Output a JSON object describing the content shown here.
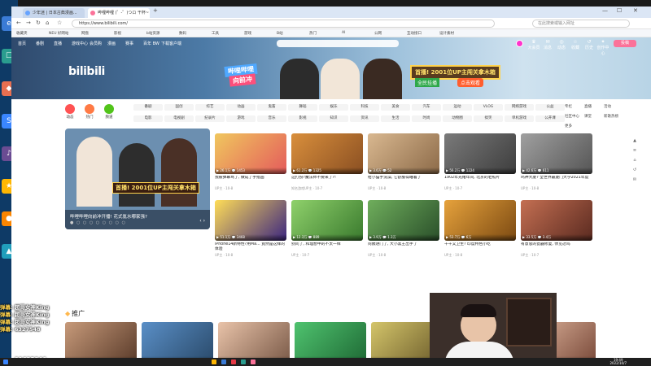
{
  "browser": {
    "tabs": [
      {
        "label": "少年迷 | 日本古典漫画..."
      },
      {
        "label": "哔哩哔哩 (゜-゜)つロ 干杯~"
      }
    ],
    "url": "https://www.bilibili.com/",
    "search_placeholder": "在此搜索或输入网址",
    "bookmarks": [
      "收藏夹",
      "NEU 好网站",
      "网盘",
      "影视",
      "b站资源",
      "数码",
      "工具",
      "游戏",
      "B站",
      "热门",
      "AI",
      "公网",
      "互动接口",
      "设计素材"
    ]
  },
  "nav": {
    "items": [
      "首页",
      "番剧",
      "直播",
      "游戏中心",
      "会员购",
      "漫画",
      "赛事",
      "百年 BW",
      "下载客户端"
    ],
    "right": [
      {
        "icon": "crown-icon",
        "label": "大会员"
      },
      {
        "icon": "message-icon",
        "label": "消息"
      },
      {
        "icon": "dynamic-icon",
        "label": "动态"
      },
      {
        "icon": "star-icon",
        "label": "收藏"
      },
      {
        "icon": "history-icon",
        "label": "历史"
      },
      {
        "icon": "bulb-icon",
        "label": "创作中心"
      }
    ],
    "upload": "投稿"
  },
  "banner": {
    "logo": "bilibili",
    "slogan_top": "哔哩哔哩",
    "slogan_bottom": "向前冲",
    "promo": "首播! 2001位UP主闯关拿木箱",
    "promo_sub": "全民挂播",
    "promo_btn": "点击观看"
  },
  "channels": {
    "big": [
      {
        "label": "动态",
        "color": "#ff5252"
      },
      {
        "label": "热门",
        "color": "#ff7a45"
      },
      {
        "label": "频道",
        "color": "#52c41a"
      }
    ],
    "row1": [
      "番剧",
      "国创",
      "综艺",
      "动画",
      "鬼畜",
      "舞蹈",
      "娱乐",
      "科技",
      "美食",
      "汽车",
      "运动",
      "VLOG",
      "网络游戏",
      "公益"
    ],
    "row2": [
      "电影",
      "电视剧",
      "纪录片",
      "游戏",
      "音乐",
      "影视",
      "知识",
      "资讯",
      "生活",
      "时尚",
      "动物圈",
      "搞笑",
      "单机游戏",
      "公开课"
    ],
    "side": [
      "专栏",
      "直播",
      "活动",
      "社区中心",
      "课堂",
      "新歌热榜",
      "更多"
    ]
  },
  "carousel": {
    "title": "哔哩哔哩向前冲开播! 花式氪水哪家强?",
    "badge": "首播! 2001位UP主闯关拿木箱",
    "dots": "● ○ ○ ○ ○ ○ ○ ○ ○"
  },
  "cards_top": [
    {
      "title": "我被弹幕骂了, 做成了手指画",
      "author": "UP主 · 10-8",
      "stats": "▶ 26.1万  💬 1453",
      "c1": "#f0c75e",
      "c2": "#e45b5b"
    },
    {
      "title": "这打扮?魔法师不要来了?!",
      "author": "知名游戏UP主 · 10-7",
      "stats": "▶ 61.2万  💬 1325",
      "c1": "#d98f3c",
      "c2": "#8a4f22"
    },
    {
      "title": "给小猫手洗澡, 它舒服得睡着了",
      "author": "UP主 · 10-8",
      "stats": "▶ 3.6万  💬 52",
      "c1": "#d9b890",
      "c2": "#8c6a48"
    },
    {
      "title": "1902年光绪年间, 北京的老照片",
      "author": "UP主 · 10-7",
      "stats": "▶ 56.2万  💬 1224",
      "c1": "#7a7a7a",
      "c2": "#3d3d3d"
    },
    {
      "title": "鸣神大厦? 全世界最厦门大学2021年度",
      "author": "UP主 · 10-8",
      "stats": "▶ 42.6万  💬 611",
      "c1": "#a0a0a0",
      "c2": "#555"
    }
  ],
  "cards_mid": [
    {
      "title": "iPhone14新特性?用Ma... 竟然是这样的体验",
      "author": "UP主 · 10-8",
      "stats": "▶ 51.1万  💬 3468",
      "c1": "#ffdd57",
      "c2": "#3b2580"
    },
    {
      "title": "别问了, 和理想中的不太一样",
      "author": "UP主 · 10-7",
      "stats": "▶ 12.3万  💬 889",
      "c1": "#8fd16b",
      "c2": "#3a7a2e"
    },
    {
      "title": "阿姨进门了, 大小黑王出手了",
      "author": "UP主 · 10-8",
      "stats": "▶ 3.9万  💬 1.3万",
      "c1": "#6fae5c",
      "c2": "#2a4f2a"
    },
    {
      "title": "干干又卫生? 印度特色小吃",
      "author": "UP主 · 10-8",
      "stats": "▶ 53.7万  💬 6万",
      "c1": "#e6a23c",
      "c2": "#7c4a12"
    },
    {
      "title": "有意思的瓷器修复, 你见过吗",
      "author": "UP主 · 10-7",
      "stats": "▶ 33.5万  💬 3.4万",
      "c1": "#c46f52",
      "c2": "#5a2a20"
    }
  ],
  "section": {
    "title": "推广"
  },
  "cards_promo": [
    {
      "title": "【我的】短不要嘛一小时, 即将...",
      "author": "UP主 · 10-8",
      "stats": "",
      "c1": "#c79a7a",
      "c2": "#5a3b2a"
    },
    {
      "title": "看完我的智能动画挑战剧了",
      "author": "UP主 · 10-8",
      "stats": "",
      "c1": "#5a8fc7",
      "c2": "#2a4a6a"
    },
    {
      "title": "广告 挑战剧情一小时",
      "author": "UP主 · 10-8",
      "stats": "",
      "c1": "#e9c3a9",
      "c2": "#7a5a48"
    },
    {
      "title": "我这背景有多搞笑",
      "author": "UP主 · 10-8",
      "stats": "",
      "c1": "#4fc36f",
      "c2": "#1f6a35"
    },
    {
      "title": "每日必刷榜 | 宋 在家都有",
      "author": "UP主 · 10-8",
      "stats": "",
      "c1": "#d4c56a",
      "c2": "#6a5a2a"
    },
    {
      "title": "惊世神作 超高评分",
      "author": "UP主 · 10-8",
      "stats": "",
      "c1": "#a47a4a",
      "c2": "#4a2a1a"
    },
    {
      "title": "我在说话",
      "author": "UP主 · 10-8",
      "stats": "",
      "c1": "#e2b8a0",
      "c2": "#7a4a3a"
    }
  ],
  "chat": [
    {
      "user": "弹幕",
      "text": "超哥女神King"
    },
    {
      "user": "弹幕",
      "text": "超哥女神King"
    },
    {
      "user": "弹幕",
      "text": "超哥女神King"
    },
    {
      "user": "弹幕",
      "text": "6327548"
    }
  ],
  "counter": "91625846",
  "clock": {
    "time": "19:49",
    "date": "2022/10/7"
  },
  "right_side": [
    "▲",
    "≡",
    "⌂",
    "↺",
    "✉"
  ]
}
